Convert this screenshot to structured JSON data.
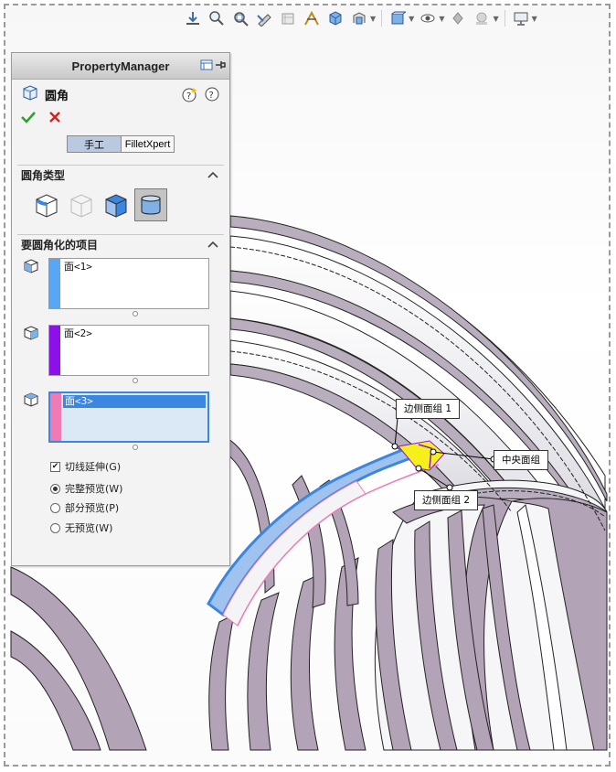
{
  "property_manager": {
    "title": "PropertyManager",
    "feature_name": "圆角",
    "tabs": [
      {
        "label": "手工",
        "active": true
      },
      {
        "label": "FilletXpert",
        "active": false
      }
    ],
    "fillet_type_section": {
      "title": "圆角类型",
      "types": [
        "constant-size",
        "variable-size",
        "face-fillet",
        "full-round"
      ],
      "selected": "full-round"
    },
    "items_section": {
      "title": "要圆角化的项目",
      "selections": [
        {
          "items": [
            "面<1>"
          ],
          "color": "#5aa6f2",
          "active": false
        },
        {
          "items": [
            "面<2>"
          ],
          "color": "#8c10e8",
          "active": false
        },
        {
          "items": [
            "面<3>"
          ],
          "color": "#f07ab4",
          "active": true
        }
      ],
      "tangent_propagation": {
        "label": "切线延伸(G)",
        "checked": true
      },
      "preview_options": [
        {
          "label": "完整预览(W)",
          "selected": true
        },
        {
          "label": "部分预览(P)",
          "selected": false
        },
        {
          "label": "无预览(W)",
          "selected": false
        }
      ]
    }
  },
  "callouts": {
    "side_face_set_1": "边侧面组 1",
    "center_face_set": "中央面组",
    "side_face_set_2": "边侧面组 2"
  },
  "heads_up_toolbar": [
    "zoom-to-fit-icon",
    "zoom-to-area-icon",
    "previous-view-icon",
    "section-view-icon",
    "dynamic-annotation-icon",
    "view-orientation-icon",
    "display-style-icon",
    "hide-show-icon",
    "edit-appearance-icon",
    "apply-scene-icon",
    "view-settings-icon",
    "monitor-icon"
  ],
  "colors": {
    "accent": "#3a86e0",
    "model_face": "#b3a3b6",
    "center_face": "#f5f01a"
  }
}
